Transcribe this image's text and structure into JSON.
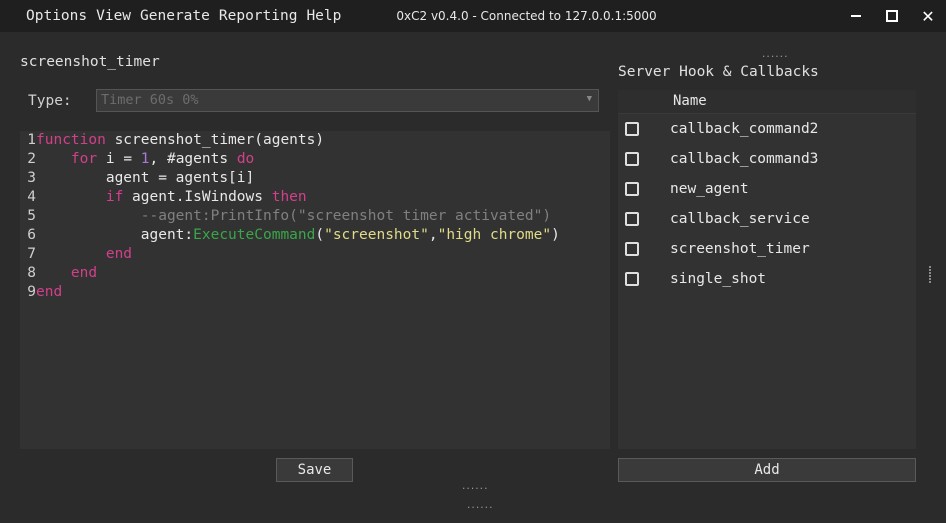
{
  "menu": [
    "Options",
    "View",
    "Generate",
    "Reporting",
    "Help"
  ],
  "connection_status": "0xC2 v0.4.0 - Connected to 127.0.0.1:5000",
  "script": {
    "name": "screenshot_timer",
    "type_label": "Type:",
    "type_value": "Timer 60s 0%",
    "save_label": "Save",
    "code": [
      [
        [
          "1",
          "ln"
        ],
        [
          "function",
          "kw"
        ],
        [
          " screenshot_timer(agents)",
          "tx"
        ]
      ],
      [
        [
          "2",
          "ln"
        ],
        [
          "    ",
          "tx"
        ],
        [
          "for",
          "kw"
        ],
        [
          " i = ",
          "tx"
        ],
        [
          "1",
          "num"
        ],
        [
          ", #agents ",
          "tx"
        ],
        [
          "do",
          "kw"
        ]
      ],
      [
        [
          "3",
          "ln"
        ],
        [
          "        agent = agents[i]",
          "tx"
        ]
      ],
      [
        [
          "4",
          "ln"
        ],
        [
          "        ",
          "tx"
        ],
        [
          "if",
          "kw"
        ],
        [
          " agent.IsWindows ",
          "tx"
        ],
        [
          "then",
          "kw"
        ]
      ],
      [
        [
          "5",
          "ln"
        ],
        [
          "            --agent:PrintInfo(\"screenshot timer activated\")",
          "cm"
        ]
      ],
      [
        [
          "6",
          "ln"
        ],
        [
          "            agent:",
          "tx"
        ],
        [
          "ExecuteCommand",
          "fn"
        ],
        [
          "(",
          "tx"
        ],
        [
          "\"screenshot\"",
          "str"
        ],
        [
          ",",
          "tx"
        ],
        [
          "\"high chrome\"",
          "str"
        ],
        [
          ")",
          "tx"
        ]
      ],
      [
        [
          "7",
          "ln"
        ],
        [
          "        ",
          "tx"
        ],
        [
          "end",
          "kw"
        ]
      ],
      [
        [
          "8",
          "ln"
        ],
        [
          "    ",
          "tx"
        ],
        [
          "end",
          "kw"
        ]
      ],
      [
        [
          "9",
          "ln"
        ],
        [
          "end",
          "kw"
        ]
      ]
    ]
  },
  "callbacks": {
    "title": "Server Hook & Callbacks",
    "column_name": "Name",
    "items": [
      {
        "name": "callback_command2",
        "checked": false
      },
      {
        "name": "callback_command3",
        "checked": false
      },
      {
        "name": "new_agent",
        "checked": false
      },
      {
        "name": "callback_service",
        "checked": false
      },
      {
        "name": "screenshot_timer",
        "checked": false
      },
      {
        "name": "single_shot",
        "checked": false
      }
    ],
    "add_label": "Add"
  },
  "icons": {
    "minimize": "minimize-icon",
    "maximize": "maximize-icon",
    "close": "close-icon",
    "dropdown": "chevron-down-icon",
    "checkbox": "checkbox-unchecked-icon"
  }
}
